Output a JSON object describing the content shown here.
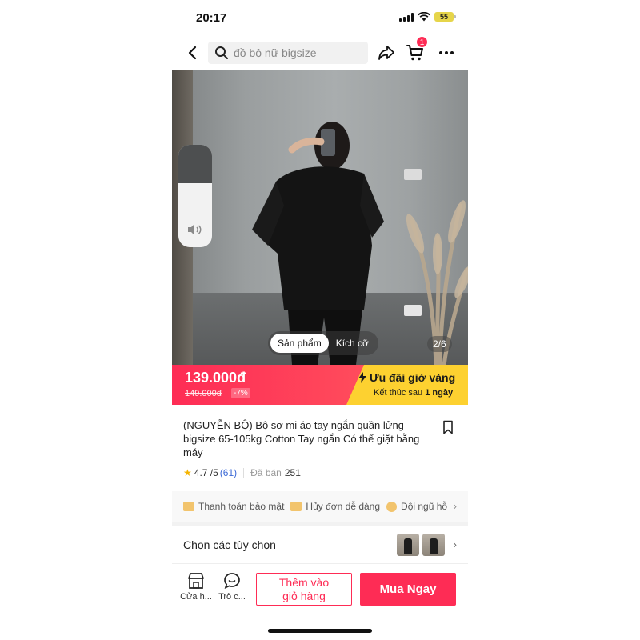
{
  "status_bar": {
    "time": "20:17",
    "battery": "55"
  },
  "search": {
    "placeholder": "đồ bộ nữ bigsize"
  },
  "cart": {
    "badge": "1"
  },
  "image": {
    "tabs": [
      "Sản phẩm",
      "Kích cỡ"
    ],
    "active_tab": 0,
    "counter": "2/6"
  },
  "price": {
    "current": "139.000đ",
    "original": "149.000đ",
    "discount": "-7%"
  },
  "deal": {
    "title": "Ưu đãi giờ vàng",
    "subtitle_prefix": "Kết thúc sau",
    "subtitle_time": "1 ngày"
  },
  "product": {
    "title": "(NGUYỄN BỘ) Bộ sơ mi áo tay ngắn quần lửng bigsize 65-105kg Cotton Tay ngắn Có thể giặt bằng máy",
    "rating": "4.7 /5",
    "rating_count": "(61)",
    "sold_label": "Đã bán",
    "sold_count": "251"
  },
  "benefits": [
    "Thanh toán bảo mật",
    "Hủy đơn dễ dàng",
    "Đội ngũ hỗ"
  ],
  "options": {
    "label": "Chọn các tùy chọn"
  },
  "bottom_bar": {
    "shop_label": "Cửa h...",
    "chat_label": "Trò c...",
    "add_to_cart": [
      "Thêm vào",
      "giỏ hàng"
    ],
    "buy_now": "Mua Ngay"
  },
  "colors": {
    "accent": "#fe2c55",
    "deal_yellow": "#fdd130",
    "rating_star": "#f5b400"
  },
  "icons": [
    "back-arrow-icon",
    "search-icon",
    "share-icon",
    "cart-icon",
    "more-icon",
    "speaker-icon",
    "bolt-icon",
    "bookmark-icon",
    "star-icon",
    "chevron-right-icon",
    "shop-icon",
    "chat-icon"
  ]
}
